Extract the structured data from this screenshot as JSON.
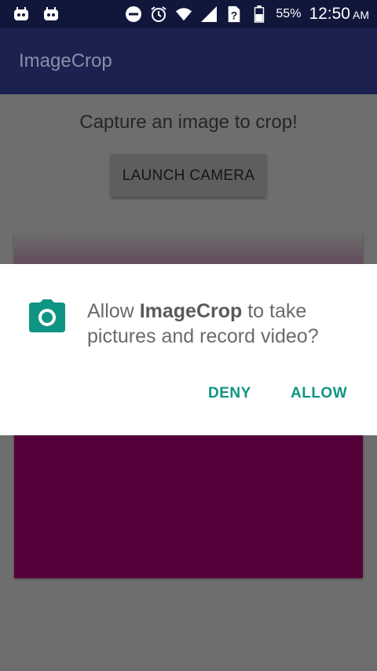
{
  "status_bar": {
    "battery_percent": "55%",
    "time": "12:50",
    "ampm": "AM",
    "icons": [
      "android-icon",
      "android-icon",
      "do-not-disturb-icon",
      "alarm-icon",
      "wifi-icon",
      "signal-icon",
      "sim-unknown-icon",
      "battery-icon"
    ]
  },
  "app_bar": {
    "title": "ImageCrop"
  },
  "main": {
    "prompt": "Capture an image to crop!",
    "launch_button": "LAUNCH CAMERA",
    "image_color": "#560039"
  },
  "dialog": {
    "message_prefix": "Allow ",
    "app_name": "ImageCrop",
    "message_suffix": " to take pictures and record video?",
    "deny": "DENY",
    "allow": "ALLOW",
    "accent": "#0f9583"
  }
}
